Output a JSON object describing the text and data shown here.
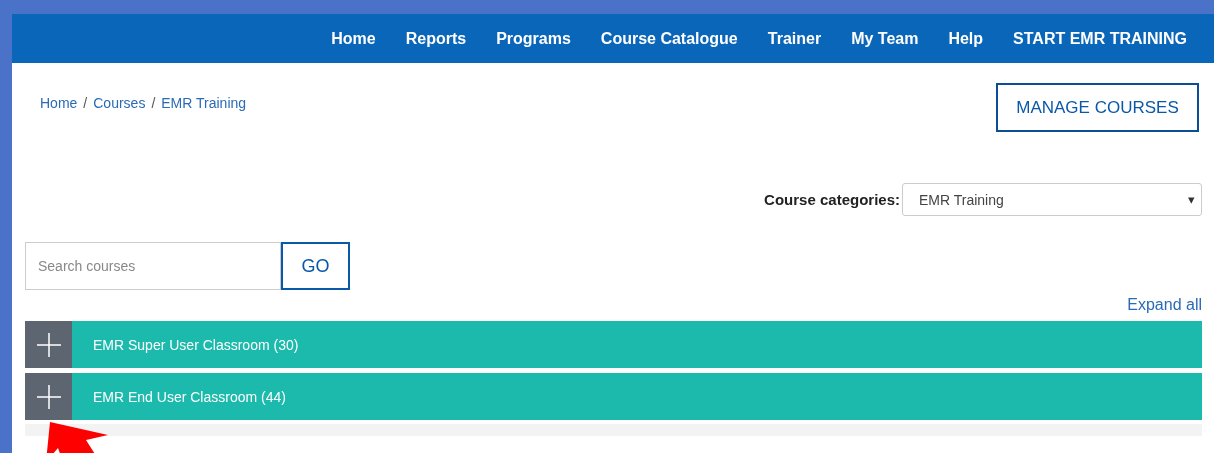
{
  "nav": {
    "items": [
      {
        "label": "Home"
      },
      {
        "label": "Reports"
      },
      {
        "label": "Programs"
      },
      {
        "label": "Course Catalogue"
      },
      {
        "label": "Trainer"
      },
      {
        "label": "My Team"
      },
      {
        "label": "Help"
      },
      {
        "label": "START EMR TRAINING"
      }
    ]
  },
  "breadcrumb": [
    {
      "label": "Home",
      "separator": "/"
    },
    {
      "label": "Courses",
      "separator": "/"
    },
    {
      "label": "EMR Training"
    }
  ],
  "manage_button": "MANAGE COURSES",
  "category_filter": {
    "label": "Course categories:",
    "value": "EMR Training",
    "caret": "▾"
  },
  "search": {
    "placeholder": "Search courses",
    "button": "GO"
  },
  "expand_all": "Expand all",
  "categories": [
    {
      "name": "EMR Super User Classroom (30)",
      "expanded": false
    },
    {
      "name": "EMR End User Classroom (44)",
      "expanded": false
    }
  ]
}
